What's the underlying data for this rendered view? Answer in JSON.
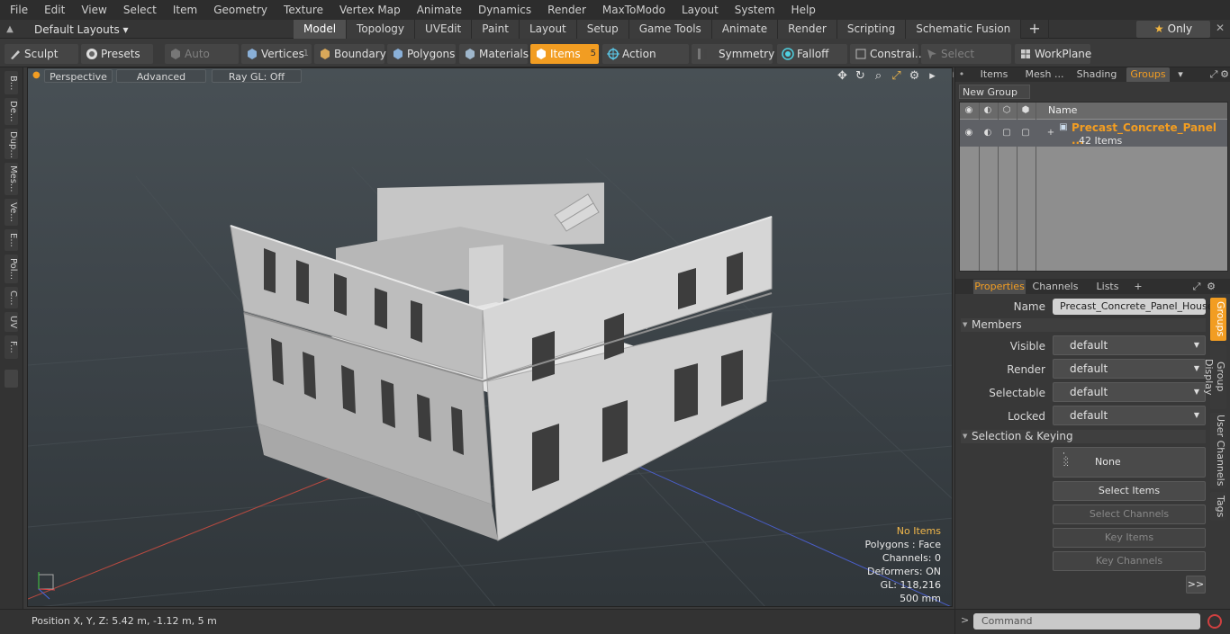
{
  "menu": [
    "File",
    "Edit",
    "View",
    "Select",
    "Item",
    "Geometry",
    "Texture",
    "Vertex Map",
    "Animate",
    "Dynamics",
    "Render",
    "MaxToModo",
    "Layout",
    "System",
    "Help"
  ],
  "layout": {
    "name": "Default Layouts ▾",
    "tabs": [
      "Model",
      "Topology",
      "UVEdit",
      "Paint",
      "Layout",
      "Setup",
      "Game Tools",
      "Animate",
      "Render",
      "Scripting",
      "Schematic Fusion"
    ],
    "active_tab": "Model",
    "only_label": "Only"
  },
  "toolbar": {
    "sculpt": "Sculpt",
    "presets": "Presets",
    "auto_select": "Auto Select",
    "vertices": "Vertices",
    "vertices_count": "1",
    "boundary": "Boundary",
    "polygons": "Polygons",
    "materials": "Materials",
    "items": "Items",
    "items_count": "5",
    "action_center": "Action Center",
    "symmetry": "Symmetry",
    "falloff": "Falloff",
    "constraints": "Constrai...",
    "select_through": "Select Through",
    "workplane": "WorkPlane"
  },
  "left_strip": [
    "B...",
    "De...",
    "Dup...",
    "Mes...",
    "Ve...",
    "E...",
    "Pol...",
    "C...",
    "UV",
    "F..."
  ],
  "viewport": {
    "perspective": "Perspective",
    "advanced": "Advanced",
    "raygl": "Ray GL: Off",
    "info": {
      "no_items": "No Items",
      "polygons": "Polygons : Face",
      "channels": "Channels: 0",
      "deformers": "Deformers: ON",
      "gl": "GL: 118,216",
      "scale": "500 mm"
    }
  },
  "status": {
    "position": "Position X, Y, Z:   5.42 m, -1.12 m, 5 m"
  },
  "groups_panel": {
    "tabs": [
      "Items",
      "Mesh ...",
      "Shading",
      "Groups"
    ],
    "active_tab": "Groups",
    "new_group": "New Group",
    "name_header": "Name",
    "item_name": "Precast_Concrete_Panel ...",
    "item_count": "42 Items"
  },
  "properties": {
    "tabs": [
      "Properties",
      "Channels",
      "Lists",
      "+"
    ],
    "active_tab": "Properties",
    "name_label": "Name",
    "name_value": "Precast_Concrete_Panel_House",
    "members_header": "Members",
    "visible_label": "Visible",
    "visible_value": "default",
    "render_label": "Render",
    "render_value": "default",
    "selectable_label": "Selectable",
    "selectable_value": "default",
    "locked_label": "Locked",
    "locked_value": "default",
    "selection_header": "Selection & Keying",
    "none_label": "None",
    "select_items": "Select Items",
    "select_channels": "Select Channels",
    "key_items": "Key Items",
    "key_channels": "Key Channels",
    "more": ">>",
    "side_tabs": [
      "Groups",
      "Group Display",
      "User Channels",
      "Tags"
    ]
  },
  "command": {
    "placeholder": "Command"
  },
  "colors": {
    "accent": "#f29d22"
  }
}
